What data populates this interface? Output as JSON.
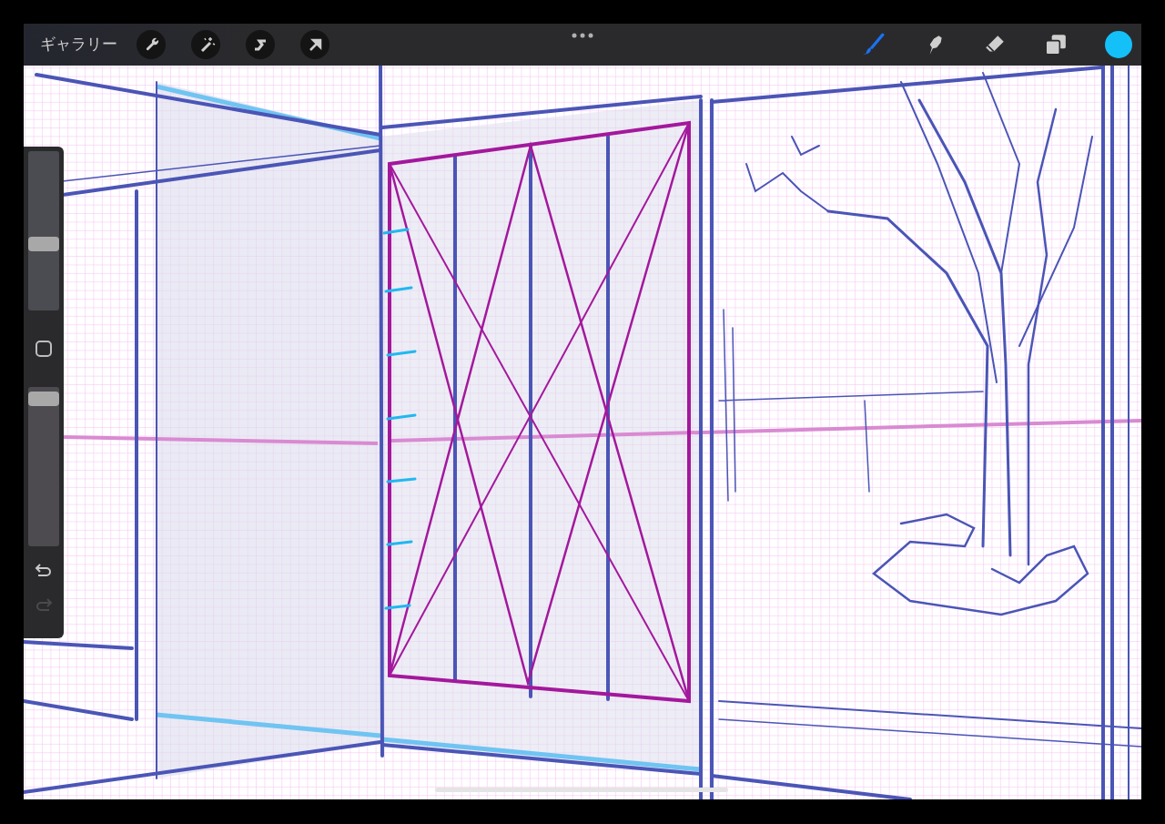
{
  "top_bar": {
    "gallery_label": "ギャラリー",
    "left_tools": [
      {
        "kind": "wrench",
        "selected": false
      },
      {
        "kind": "wand",
        "selected": false
      },
      {
        "kind": "selection",
        "selected": false
      },
      {
        "kind": "arrow",
        "selected": false
      }
    ],
    "right_tools": [
      {
        "kind": "brush",
        "selected": true
      },
      {
        "kind": "smudge",
        "selected": false
      },
      {
        "kind": "eraser",
        "selected": false
      },
      {
        "kind": "layers",
        "selected": false
      }
    ],
    "color_swatch": {
      "color": "#14c0f8"
    }
  },
  "sidebar": {
    "sliders": [
      {
        "level": 0.41
      },
      {
        "level": 0.97
      }
    ],
    "undo": {
      "disabled": false
    },
    "redo": {
      "disabled": true
    }
  }
}
